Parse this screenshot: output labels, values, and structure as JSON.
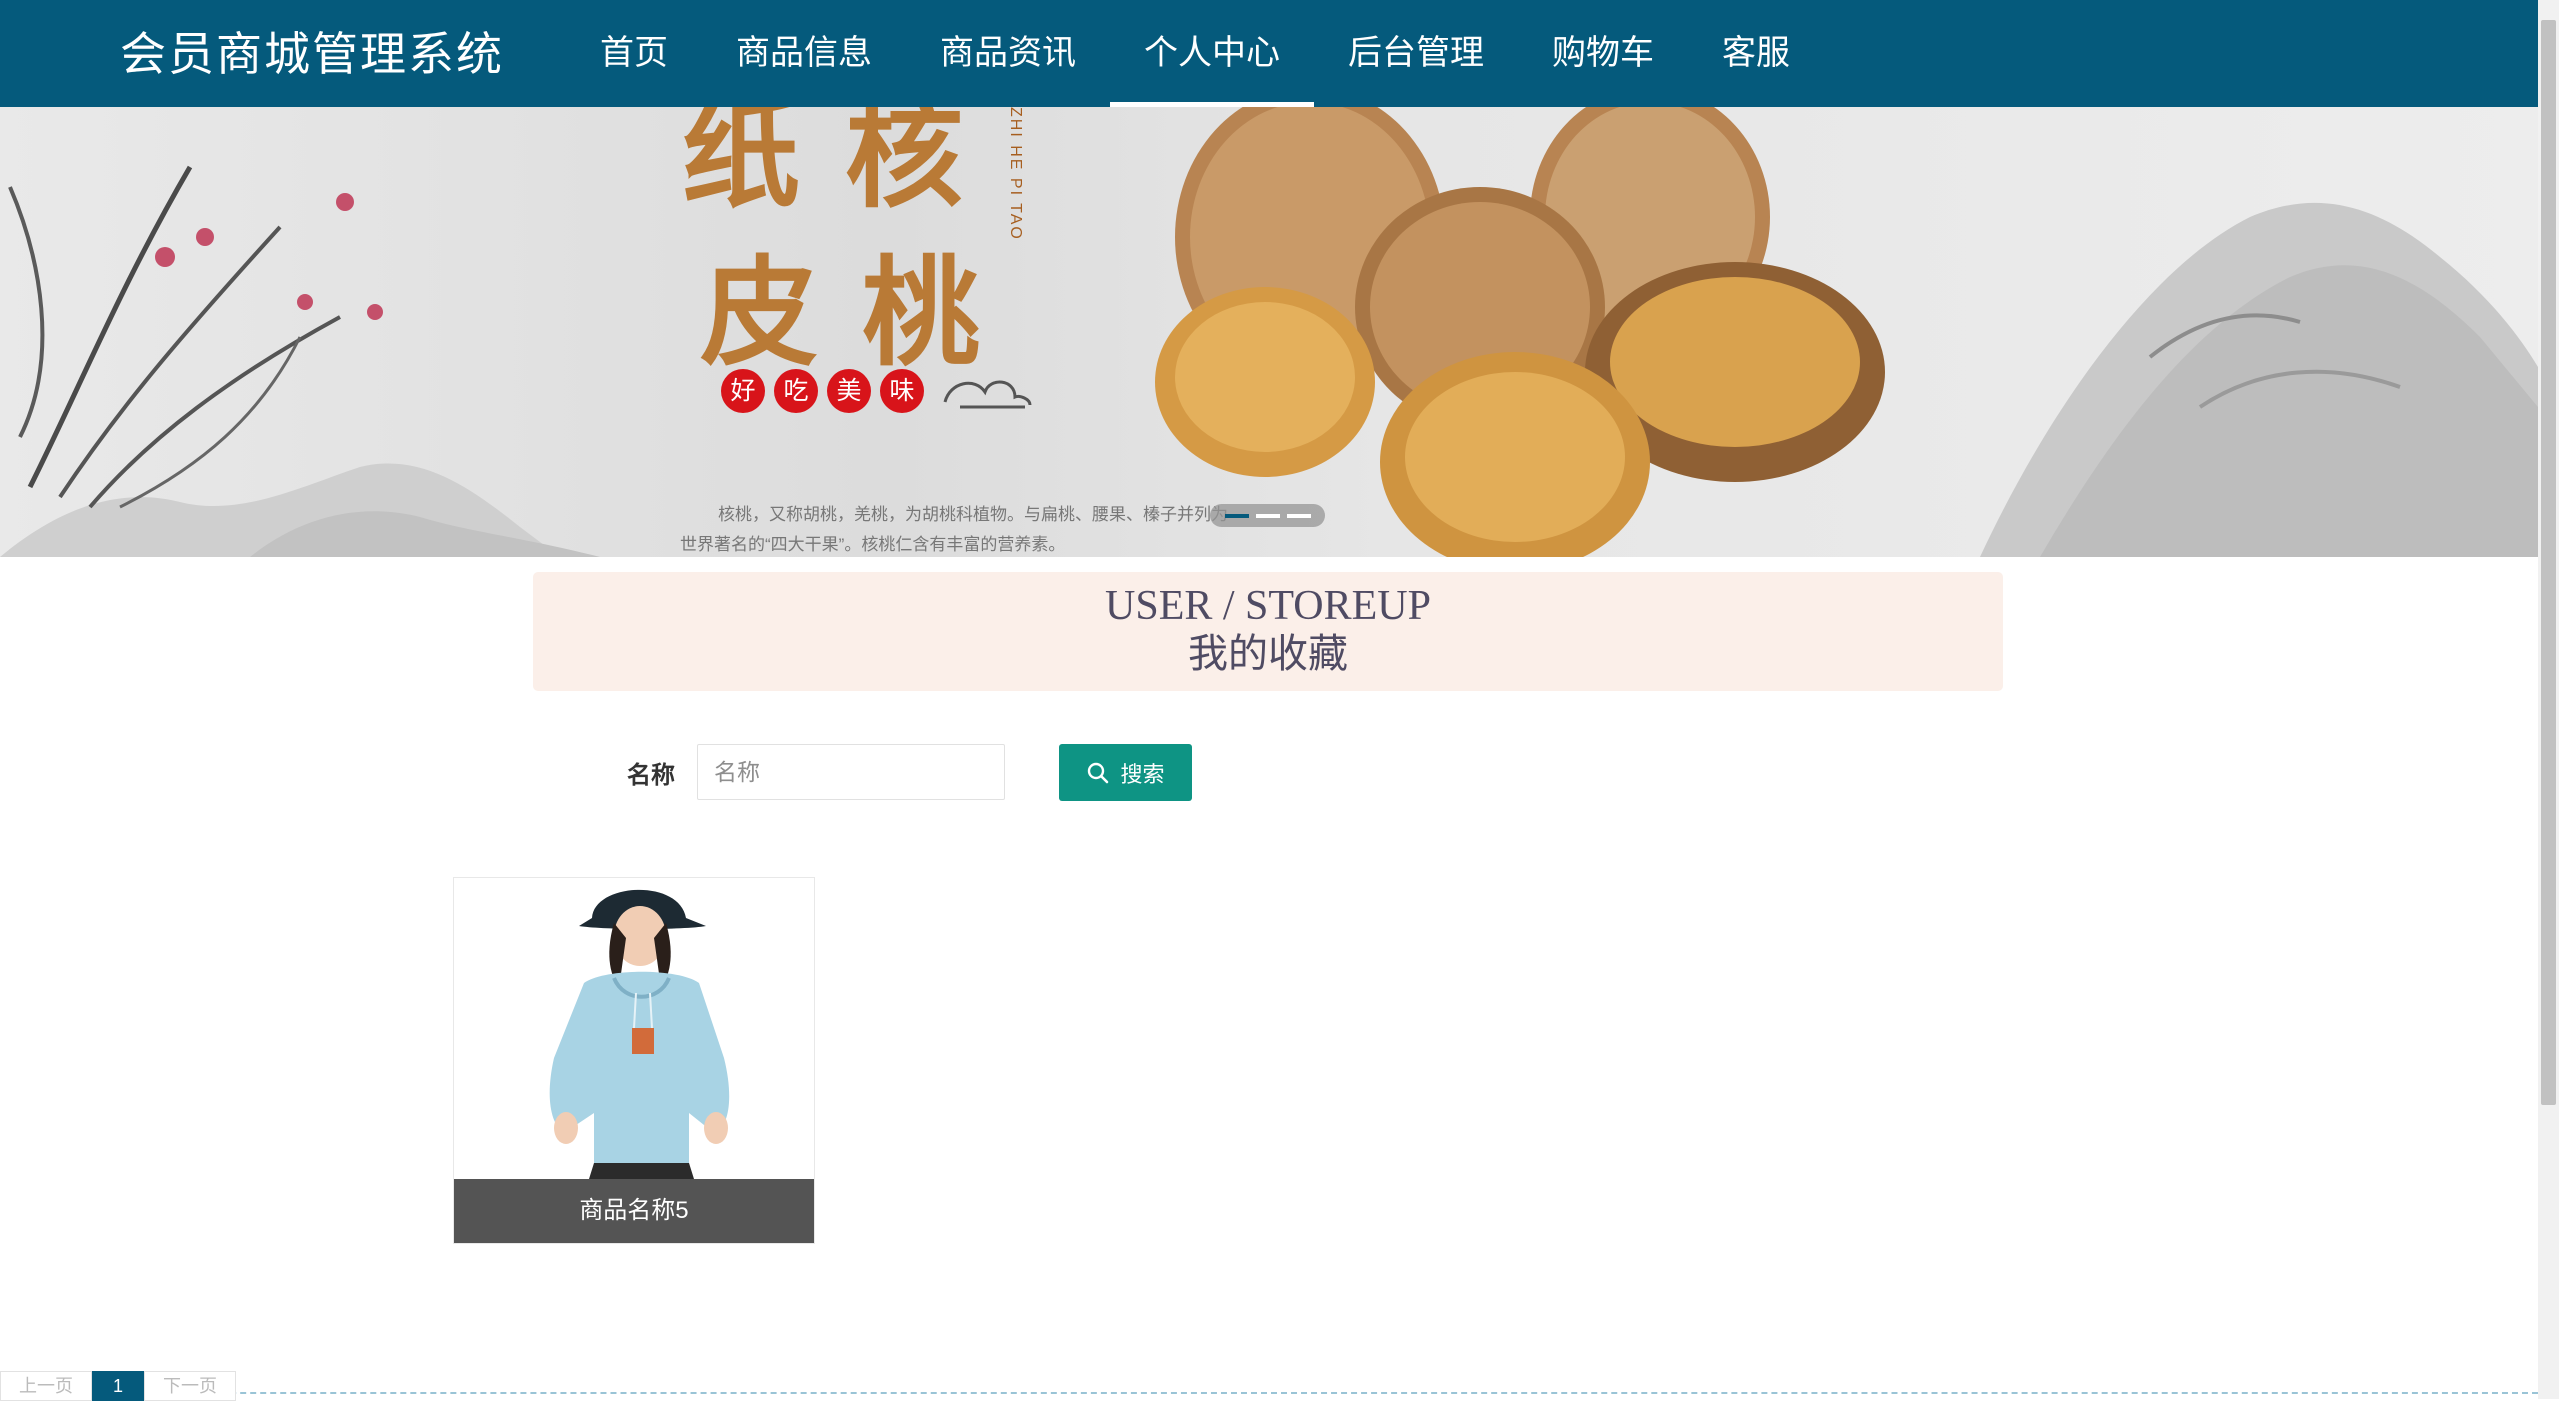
{
  "header": {
    "brand": "会员商城管理系统",
    "nav": [
      {
        "label": "首页"
      },
      {
        "label": "商品信息"
      },
      {
        "label": "商品资讯"
      },
      {
        "label": "个人中心",
        "active": true
      },
      {
        "label": "后台管理"
      },
      {
        "label": "购物车"
      },
      {
        "label": "客服"
      }
    ]
  },
  "banner": {
    "title_chars": [
      "纸",
      "核",
      "皮",
      "桃"
    ],
    "pinyin": "ZHI HE PI TAO",
    "tags": [
      "好",
      "吃",
      "美",
      "味"
    ],
    "description": "核桃，又称胡桃，羌桃，为胡桃科植物。与扁桃、腰果、榛子并列为世界著名的“四大干果”。核桃仁含有丰富的营养素。",
    "slide_count": 3,
    "active_slide": 1
  },
  "section": {
    "title_en": "USER / STOREUP",
    "title_cn": "我的收藏"
  },
  "search": {
    "label": "名称",
    "placeholder": "名称",
    "value": "",
    "button_label": "搜索"
  },
  "products": [
    {
      "name": "商品名称5"
    }
  ],
  "pagination": {
    "prev_label": "上一页",
    "current_page": "1",
    "next_label": "下一页"
  },
  "colors": {
    "nav_bg": "#055a7c",
    "search_button": "#0e9484",
    "heading_bg": "#fbefe9",
    "card_caption_bg": "#545454"
  }
}
